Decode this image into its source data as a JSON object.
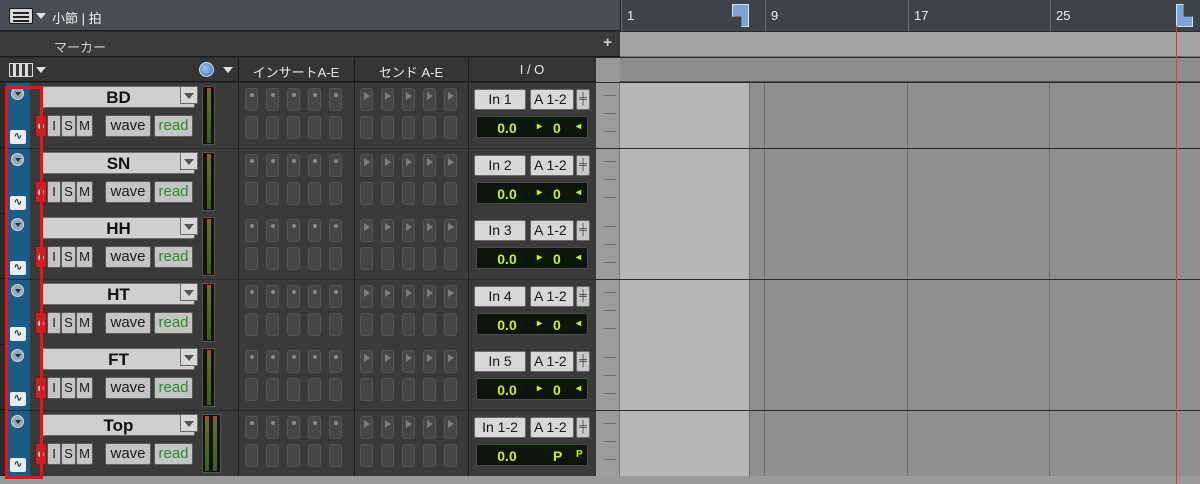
{
  "ruler": {
    "name": "小節 | 拍",
    "bars": [
      "1",
      "9",
      "17",
      "25"
    ]
  },
  "marker": {
    "label": "マーカー"
  },
  "columns": {
    "inserts": "インサートA-E",
    "sends": "センド A-E",
    "io": "I / O"
  },
  "tracks": [
    {
      "name": "BD",
      "rec": "●",
      "input": "I",
      "solo": "S",
      "mute": "M",
      "playlist": "wave",
      "automation": "read",
      "io_in": "In 1",
      "io_out": "A 1-2",
      "volume": "0.0",
      "pan_l": "▸",
      "pan": "0",
      "pan_r": "◂"
    },
    {
      "name": "SN",
      "rec": "●",
      "input": "I",
      "solo": "S",
      "mute": "M",
      "playlist": "wave",
      "automation": "read",
      "io_in": "In 2",
      "io_out": "A 1-2",
      "volume": "0.0",
      "pan_l": "▸",
      "pan": "0",
      "pan_r": "◂"
    },
    {
      "name": "HH",
      "rec": "●",
      "input": "I",
      "solo": "S",
      "mute": "M",
      "playlist": "wave",
      "automation": "read",
      "io_in": "In 3",
      "io_out": "A 1-2",
      "volume": "0.0",
      "pan_l": "▸",
      "pan": "0",
      "pan_r": "◂"
    },
    {
      "name": "HT",
      "rec": "●",
      "input": "I",
      "solo": "S",
      "mute": "M",
      "playlist": "wave",
      "automation": "read",
      "io_in": "In 4",
      "io_out": "A 1-2",
      "volume": "0.0",
      "pan_l": "▸",
      "pan": "0",
      "pan_r": "◂"
    },
    {
      "name": "FT",
      "rec": "●",
      "input": "I",
      "solo": "S",
      "mute": "M",
      "playlist": "wave",
      "automation": "read",
      "io_in": "In 5",
      "io_out": "A 1-2",
      "volume": "0.0",
      "pan_l": "▸",
      "pan": "0",
      "pan_r": "◂"
    },
    {
      "name": "Top",
      "rec": "●",
      "input": "I",
      "solo": "S",
      "mute": "M",
      "playlist": "wave",
      "automation": "read",
      "io_in": "In 1-2",
      "io_out": "A 1-2",
      "volume": "0.0",
      "pan_l": "",
      "pan": "P",
      "pan_r": "P"
    }
  ],
  "colors": {
    "track_strip": "#1d5c86",
    "highlight": "#e5151b",
    "automation_read": "#2b8a2b",
    "volume_text": "#c9f02d"
  }
}
